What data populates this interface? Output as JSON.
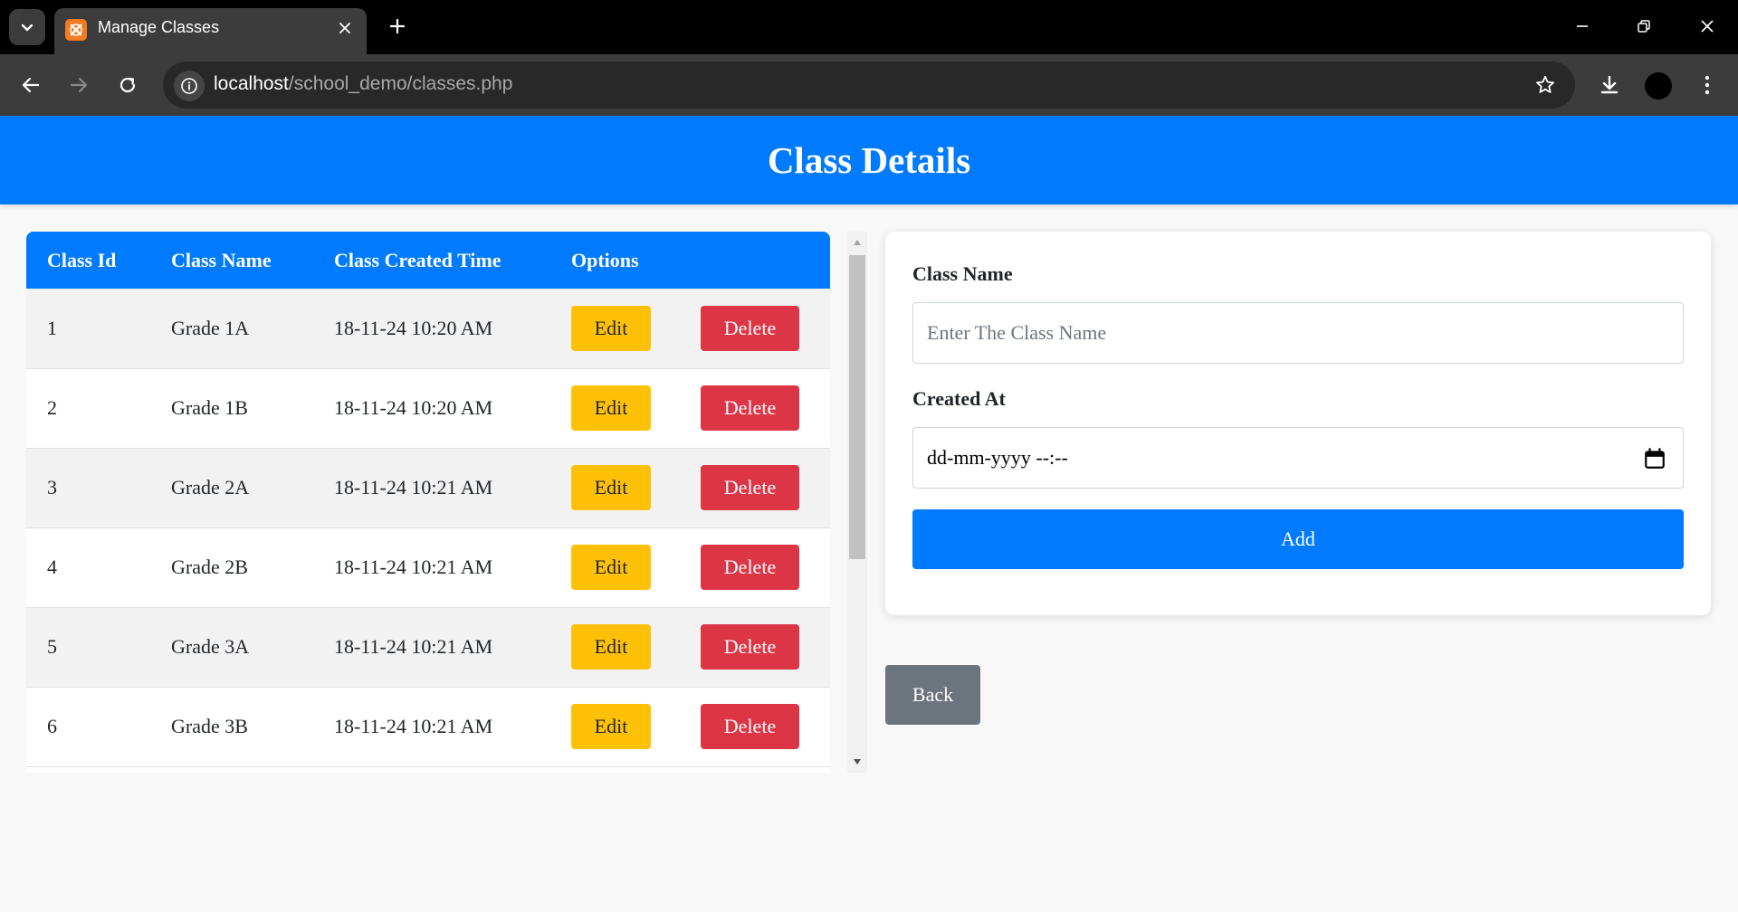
{
  "browser": {
    "tab_title": "Manage Classes",
    "url_host": "localhost",
    "url_path": "/school_demo/classes.php"
  },
  "page": {
    "title": "Class Details"
  },
  "table": {
    "headers": [
      "Class Id",
      "Class Name",
      "Class Created Time",
      "Options"
    ],
    "rows": [
      {
        "id": "1",
        "name": "Grade 1A",
        "created": "18-11-24 10:20 AM"
      },
      {
        "id": "2",
        "name": "Grade 1B",
        "created": "18-11-24 10:20 AM"
      },
      {
        "id": "3",
        "name": "Grade 2A",
        "created": "18-11-24 10:21 AM"
      },
      {
        "id": "4",
        "name": "Grade 2B",
        "created": "18-11-24 10:21 AM"
      },
      {
        "id": "5",
        "name": "Grade 3A",
        "created": "18-11-24 10:21 AM"
      },
      {
        "id": "6",
        "name": "Grade 3B",
        "created": "18-11-24 10:21 AM"
      }
    ],
    "edit_label": "Edit",
    "delete_label": "Delete"
  },
  "form": {
    "class_name_label": "Class Name",
    "class_name_placeholder": "Enter The Class Name",
    "created_at_label": "Created At",
    "created_at_value": "dd-mm-yyyy --:--",
    "add_label": "Add"
  },
  "back_label": "Back",
  "colors": {
    "primary": "#007bff",
    "edit": "#ffc107",
    "delete": "#dc3545",
    "back": "#6c757d"
  },
  "icons": {
    "tab_search": "chevron-down-icon",
    "favicon": "xampp-icon",
    "tab_close": "close-icon",
    "new_tab": "plus-icon",
    "back": "arrow-left-icon",
    "forward": "arrow-right-icon",
    "reload": "reload-icon",
    "site_info": "info-icon",
    "bookmark": "star-icon",
    "downloads": "download-icon",
    "menu": "kebab-menu-icon",
    "calendar": "calendar-icon"
  }
}
